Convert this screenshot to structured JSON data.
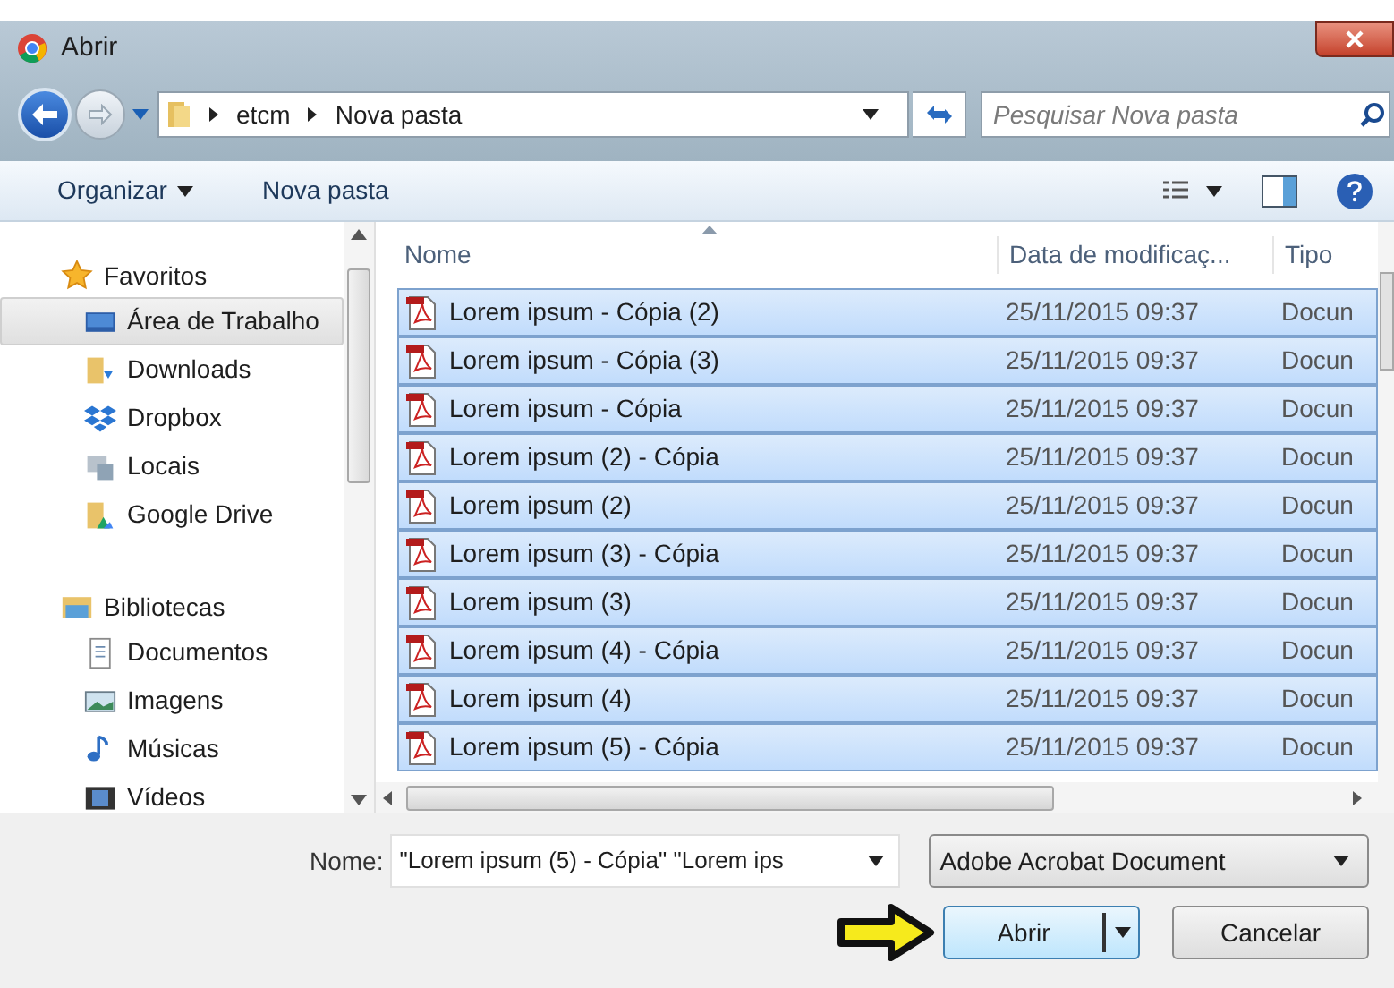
{
  "window": {
    "title": "Abrir"
  },
  "address": {
    "segments": [
      "etcm",
      "Nova pasta"
    ]
  },
  "search": {
    "placeholder": "Pesquisar Nova pasta"
  },
  "toolbar": {
    "organize": "Organizar",
    "new_folder": "Nova pasta"
  },
  "sidebar": {
    "groups": [
      {
        "label": "Favoritos",
        "kind": "star",
        "children": [
          {
            "label": "Área de Trabalho",
            "kind": "desktop",
            "selected": true
          },
          {
            "label": "Downloads",
            "kind": "downloads",
            "selected": false
          },
          {
            "label": "Dropbox",
            "kind": "dropbox",
            "selected": false
          },
          {
            "label": "Locais",
            "kind": "places",
            "selected": false
          },
          {
            "label": "Google Drive",
            "kind": "gdrive",
            "selected": false
          }
        ]
      },
      {
        "label": "Bibliotecas",
        "kind": "library",
        "children": [
          {
            "label": "Documentos",
            "kind": "documents",
            "selected": false
          },
          {
            "label": "Imagens",
            "kind": "images",
            "selected": false
          },
          {
            "label": "Músicas",
            "kind": "music",
            "selected": false
          },
          {
            "label": "Vídeos",
            "kind": "videos",
            "selected": false
          }
        ]
      }
    ]
  },
  "table": {
    "columns": [
      "Nome",
      "Data de modificaç...",
      "Tipo"
    ],
    "rows": [
      {
        "name": "Lorem ipsum - Cópia (2)",
        "date": "25/11/2015 09:37",
        "type": "Docun",
        "selected": true
      },
      {
        "name": "Lorem ipsum - Cópia (3)",
        "date": "25/11/2015 09:37",
        "type": "Docun",
        "selected": true
      },
      {
        "name": "Lorem ipsum - Cópia",
        "date": "25/11/2015 09:37",
        "type": "Docun",
        "selected": true
      },
      {
        "name": "Lorem ipsum (2) - Cópia",
        "date": "25/11/2015 09:37",
        "type": "Docun",
        "selected": true
      },
      {
        "name": "Lorem ipsum (2)",
        "date": "25/11/2015 09:37",
        "type": "Docun",
        "selected": true
      },
      {
        "name": "Lorem ipsum (3) - Cópia",
        "date": "25/11/2015 09:37",
        "type": "Docun",
        "selected": true
      },
      {
        "name": "Lorem ipsum (3)",
        "date": "25/11/2015 09:37",
        "type": "Docun",
        "selected": true
      },
      {
        "name": "Lorem ipsum (4) - Cópia",
        "date": "25/11/2015 09:37",
        "type": "Docun",
        "selected": true
      },
      {
        "name": "Lorem ipsum (4)",
        "date": "25/11/2015 09:37",
        "type": "Docun",
        "selected": true
      },
      {
        "name": "Lorem ipsum (5) - Cópia",
        "date": "25/11/2015 09:37",
        "type": "Docun",
        "selected": true
      }
    ]
  },
  "footer": {
    "name_label": "Nome:",
    "name_value": "\"Lorem ipsum (5) - Cópia\" \"Lorem ips",
    "file_type": "Adobe Acrobat Document",
    "open": "Abrir",
    "cancel": "Cancelar"
  }
}
